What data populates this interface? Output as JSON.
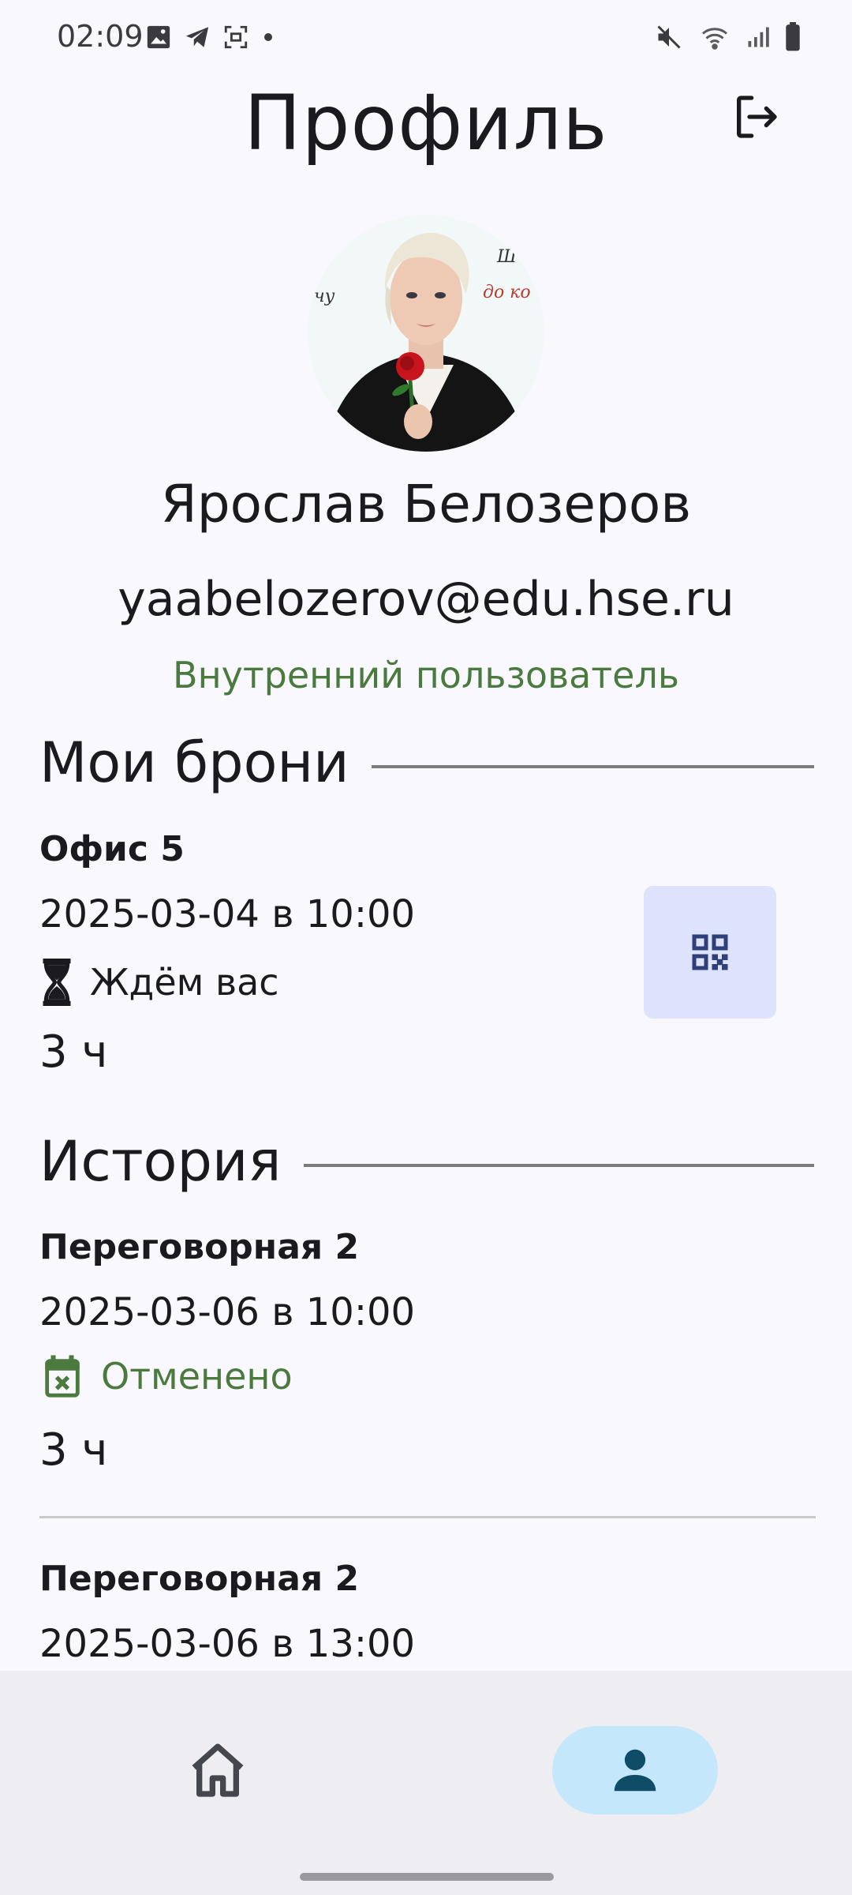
{
  "status_bar": {
    "time": "02:09",
    "left_icons": [
      "image-icon",
      "telegram-icon",
      "screenshot-icon",
      "dot-icon"
    ],
    "right_icons": [
      "mute-icon",
      "wifi-icon",
      "signal-icon",
      "battery-icon"
    ]
  },
  "header": {
    "title": "Профиль",
    "logout_icon": "logout-icon"
  },
  "profile": {
    "name": "Ярослав Белозеров",
    "email": "yaabelozerov@edu.hse.ru",
    "role": "Внутренний пользователь",
    "role_color": "#4b7a3e"
  },
  "bookings": {
    "section_title": "Мои брони",
    "items": [
      {
        "title": "Офис 5",
        "date": "2025-03-04 в 10:00",
        "status_icon": "hourglass-icon",
        "status": "Ждём вас",
        "duration": "3 ч",
        "action_icon": "qr-code-icon"
      }
    ]
  },
  "history": {
    "section_title": "История",
    "items": [
      {
        "title": "Переговорная 2",
        "date": "2025-03-06 в 10:00",
        "status_icon": "calendar-cancel-icon",
        "status": "Отменено",
        "duration": "3 ч"
      },
      {
        "title": "Переговорная 2",
        "date": "2025-03-06 в 13:00"
      }
    ]
  },
  "bottom_nav": {
    "items": [
      {
        "icon": "home-icon",
        "active": false
      },
      {
        "icon": "profile-icon",
        "active": true
      }
    ],
    "active_color": "#c5e7fb"
  }
}
